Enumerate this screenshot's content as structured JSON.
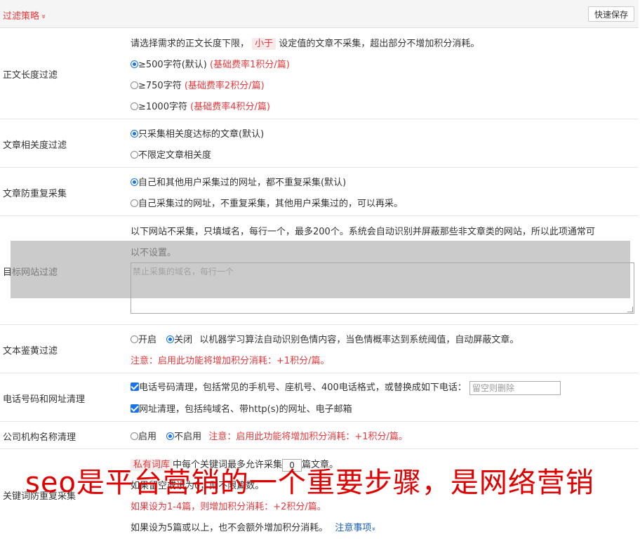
{
  "header": {
    "title": "过滤策略",
    "chevron": "»",
    "quick_save": "快速保存"
  },
  "length_filter": {
    "label": "正文长度过滤",
    "desc_pre": "请选择需求的正文长度下限，",
    "desc_tag": "小于",
    "desc_post": "设定值的文章不采集，超出部分不增加积分消耗。",
    "options": [
      {
        "text": "≥500字符(默认)",
        "note": "(基础费率1积分/篇)",
        "checked": true
      },
      {
        "text": "≥750字符",
        "note": "(基础费率2积分/篇)",
        "checked": false
      },
      {
        "text": "≥1000字符",
        "note": "(基础费率4积分/篇)",
        "checked": false
      }
    ]
  },
  "relevance_filter": {
    "label": "文章相关度过滤",
    "options": [
      {
        "text": "只采集相关度达标的文章(默认)",
        "checked": true
      },
      {
        "text": "不限定文章相关度",
        "checked": false
      }
    ]
  },
  "dedupe": {
    "label": "文章防重复采集",
    "options": [
      {
        "text": "自己和其他用户采集过的网址，都不重复采集(默认)",
        "checked": true
      },
      {
        "text": "自己采集过的网址，不重复采集，其他用户采集过的，可以再采。",
        "checked": false
      }
    ]
  },
  "site_filter": {
    "label": "目标网站过滤",
    "desc_line1": "以下网站不采集，只填域名，每行一个，最多200个。系统会自动识别并屏蔽那些非文章类的网站，所以此项通常可",
    "desc_line2": "以不设置。",
    "placeholder": "禁止采集的域名，每行一个"
  },
  "porn_filter": {
    "label": "文本鉴黄过滤",
    "on_label": "开启",
    "off_label": "关闭",
    "desc": "以机器学习算法自动识别色情内容，当色情概率达到系统阈值，自动屏蔽文章。",
    "note": "注意：启用此功能将增加积分消耗：+1积分/篇。",
    "enabled": false
  },
  "phone_clean": {
    "label": "电话号码和网址清理",
    "phone_text": "电话号码清理，包括常见的手机号、座机号、400电话格式，或替换成如下电话：",
    "phone_placeholder": "留空则删除",
    "url_text": "网址清理，包括纯域名、带http(s)的网址、电子邮箱"
  },
  "org_clean": {
    "label": "公司机构名称清理",
    "on_label": "启用",
    "off_label": "不启用",
    "note": "注意：启用此功能将增加积分消耗：+1积分/篇。",
    "enabled": false
  },
  "keyword_dedupe": {
    "label": "关键词防重复采集",
    "tag": "私有词库",
    "line1_mid": "中每个关键词最多允许采集",
    "count": "0",
    "line1_post": "篇文章。",
    "line2": "如果留空或设为0，则不限篇数。",
    "line3": "如果设为1-4篇，则增加积分消耗：+2积分/篇。",
    "line4": "如果设为5篇或以上，也不会额外增加积分消耗。",
    "link": "注意事项"
  },
  "watermark": "seo是平台营销的一个重要步骤，是网络营销",
  "colors": {
    "accent_red": "#e4393c",
    "radio_blue": "#1a73e8",
    "link_blue": "#1a5fb4"
  }
}
